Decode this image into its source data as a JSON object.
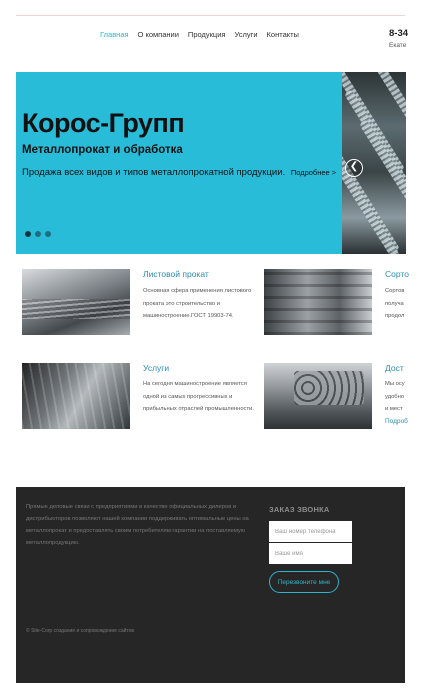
{
  "header": {
    "nav": [
      "Главная",
      "О компании",
      "Продукция",
      "Услуги",
      "Контакты"
    ],
    "phone": "8-34",
    "city": "Екате"
  },
  "hero": {
    "title": "Корос-Групп",
    "subtitle": "Металлопрокат и обработка",
    "description": "Продажа всех видов и типов металлопрокатной продукции.",
    "more": "Подробнее >",
    "slides_total": 3,
    "slide_active": 1
  },
  "cards": [
    {
      "title": "Листовой прокат",
      "lines": [
        "Основная сфера применения листового",
        "проката это строительство и",
        "машиностроение.ГОСТ 19903-74."
      ],
      "link": ""
    },
    {
      "title": "Сорто",
      "lines": [
        "Сортов",
        "получа",
        "продол"
      ],
      "link": ""
    },
    {
      "title": "Услуги",
      "lines": [
        "На сегодня машиностроение является",
        "одной из самых прогрессивных и",
        "прибыльных отраслей промышленности."
      ],
      "link": ""
    },
    {
      "title": "Дост",
      "lines": [
        "Мы осу",
        "удобно",
        "и мест"
      ],
      "link": "Подроб"
    }
  ],
  "footer": {
    "about_lines": [
      "Прямые деловые связи с предприятиями в качестве официальных дилеров и",
      "дистрибьюторов позволяют нашей компании поддерживать оптимальные цены на",
      "металлопрокат и предоставлять своим потребителям гарантии на поставляемую",
      "металлопродукцию."
    ],
    "callback_title": "ЗАКАЗ ЗВОНКА",
    "phone_placeholder": "Ваш номер телефона",
    "name_placeholder": "Ваше имя",
    "button": "Перезвоните мне",
    "copyright": "© Site-Corp создание и сопровождение сайтов"
  },
  "colors": {
    "accent": "#2fb4cc",
    "hero_bg": "#29bcd9",
    "footer_bg": "#262626",
    "link": "#2b8fb3"
  }
}
